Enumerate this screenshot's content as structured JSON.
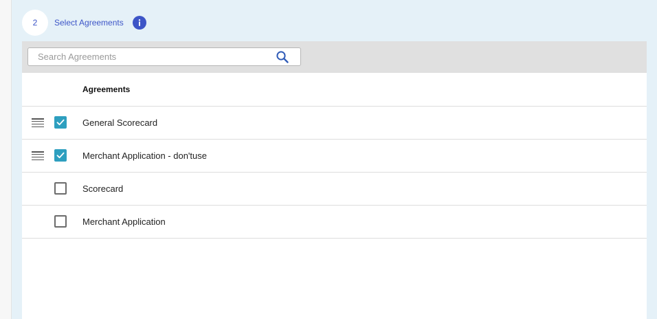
{
  "step": {
    "number": "2",
    "title": "Select Agreements",
    "info_icon": "info-icon"
  },
  "search": {
    "placeholder": "Search Agreements",
    "value": "",
    "icon": "search-icon"
  },
  "table": {
    "column_header": "Agreements",
    "rows": [
      {
        "label": "General Scorecard",
        "checked": true,
        "draggable": true
      },
      {
        "label": "Merchant Application - don'tuse",
        "checked": true,
        "draggable": true
      },
      {
        "label": "Scorecard",
        "checked": false,
        "draggable": false
      },
      {
        "label": "Merchant Application",
        "checked": false,
        "draggable": false
      }
    ]
  },
  "colors": {
    "accent": "#3d55c7",
    "checkbox_checked": "#2e9fbf",
    "panel_background": "#e5f1f8"
  }
}
